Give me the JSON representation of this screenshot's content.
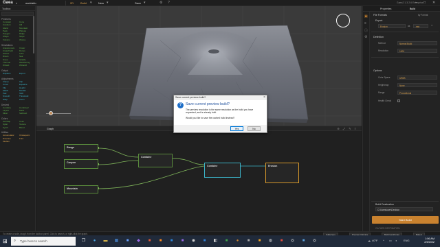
{
  "app": {
    "logo": "Gaea",
    "file_name": "worldsilo",
    "mode_build": "2D",
    "mode_default": "Build",
    "new_label": "New",
    "save_label": "Save",
    "title_right": "Gaea2 1.3.2.6 Enterprise",
    "accent": "#c9822f"
  },
  "toolbox": {
    "title": "Toolbox",
    "sections": [
      {
        "title": "Primitives",
        "color": "#5fb04a",
        "items": [
          "Constant",
          "Cone",
          "Gradient",
          "Hill",
          "Island",
          "Mountain",
          "Peak",
          "Plateau",
          "Polygon",
          "Ridge",
          "Shape",
          "Slope",
          "Volcano",
          "Worley"
        ]
      },
      {
        "title": "Simulations",
        "color": "#5fb04a",
        "items": [
          "Anastomosis",
          "Crater",
          "CraterField",
          "Dunes",
          "Glacier",
          "Lake",
          "Rivers",
          "Sea",
          "Snow",
          "Stratify",
          "Thermal",
          "Weathering",
          "Wizard",
          "Wizard2"
        ]
      },
      {
        "title": "Output",
        "color": "#3cb4c8",
        "items": [
          "Displace",
          "Export"
        ]
      },
      {
        "title": "Adjustments",
        "color": "#3cb4c8",
        "items": [
          "Clamp",
          "Clip",
          "Curve",
          "Equalize",
          "Flip",
          "Height",
          "Match",
          "Median",
          "Pad",
          "Shift",
          "Smooth",
          "Threshold",
          "Warp",
          "Zoom"
        ]
      },
      {
        "title": "Derived",
        "color": "#5fb04a",
        "items": [
          "Combine",
          "Combine2",
          "Layers",
          "Mask",
          "Mixer",
          "Subtract"
        ]
      },
      {
        "title": "Colors",
        "color": "#5fb04a",
        "items": [
          "Sat Map",
          "Color",
          "Splat",
          "Texture",
          "Synth",
          "Blend"
        ]
      },
      {
        "title": "Utilities",
        "color": "#d9a04c",
        "items": [
          "Accumulator",
          "Chokepoint",
          "Direction",
          "Fold",
          "Median"
        ]
      }
    ]
  },
  "dialog": {
    "title": "Save current preview build?",
    "heading": "Save current preview build?",
    "message": "The preview resolution is the same resolution as the build you have requested, and is already built.",
    "question": "Would you like to save the cached build instead?",
    "yes": "Yes",
    "no": "No"
  },
  "graph": {
    "tab": "Graph",
    "nodes": {
      "range": "Range",
      "canyon": "Canyon",
      "mountain": "Mountain",
      "combine1": "Combine",
      "combine2": "Combine",
      "erosion": "Erosion"
    }
  },
  "right_panel": {
    "tabs": [
      "Properties",
      "Build"
    ],
    "file_format_head": "File Formats",
    "by_format": "by Format",
    "export_head": "Export",
    "export_row": {
      "name": "Erosion",
      "as_label": "as",
      "format": ".raw"
    },
    "definition_head": "Definition",
    "method_label": "Method",
    "method_value": "Normal Build",
    "resolution_label": "Resolution",
    "resolution_value": "1000",
    "options_head": "Options",
    "color_space_label": "Color Space",
    "color_space_value": "sRGB",
    "heightmap_label": "Heightmap",
    "heightmap_value": "None",
    "range_label": "Range",
    "range_value": "Proportional",
    "health_label": "Health Check",
    "build_destination": "Build Destination",
    "destination_path": "C:\\Users\\user\\Desktop",
    "start_build": "Start Build",
    "cached_label": "CACHED DESTINATION"
  },
  "status": {
    "hint": "To create a node, drag it from the toolbox panel. Click to search, or right-click the graph.",
    "buttons": [
      "Fullscreen",
      "Preview Optimize",
      "Build Heightmap",
      "Baked"
    ]
  },
  "taskbar": {
    "search_placeholder": "Type here to search",
    "weather": "40°F",
    "lang": "ENG",
    "time": "1:06 AM",
    "date": "2/3/2022"
  }
}
